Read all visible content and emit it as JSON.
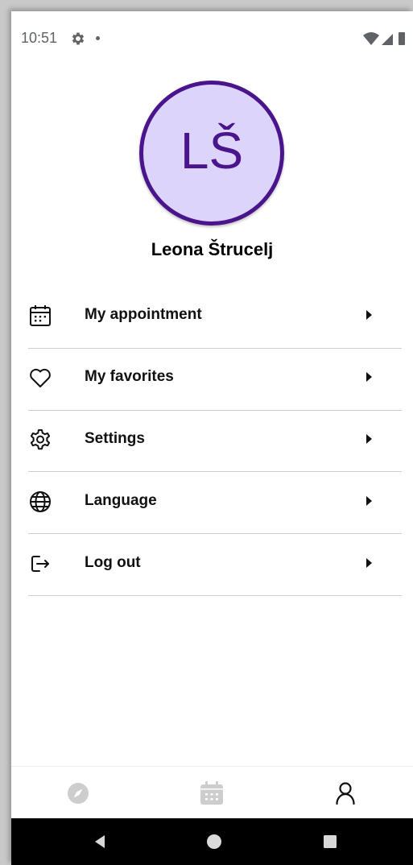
{
  "status_bar": {
    "time": "10:51",
    "icons": [
      "settings-icon",
      "notification-dot",
      "wifi-icon",
      "cellular-icon",
      "battery-icon"
    ]
  },
  "profile": {
    "initials": "LŠ",
    "name": "Leona Štrucelj",
    "avatar_bg": "#dcd4fb",
    "accent": "#4a148c"
  },
  "menu": {
    "items": [
      {
        "label": "My appointment",
        "icon": "calendar-icon"
      },
      {
        "label": "My favorites",
        "icon": "heart-icon"
      },
      {
        "label": "Settings",
        "icon": "gear-icon"
      },
      {
        "label": "Language",
        "icon": "globe-icon"
      },
      {
        "label": "Log out",
        "icon": "logout-icon"
      }
    ]
  },
  "bottom_nav": {
    "items": [
      {
        "icon": "compass-icon",
        "active": false
      },
      {
        "icon": "calendar-icon",
        "active": false
      },
      {
        "icon": "person-icon",
        "active": true
      }
    ]
  },
  "system_nav": {
    "buttons": [
      "back-icon",
      "home-icon",
      "recents-icon"
    ]
  }
}
